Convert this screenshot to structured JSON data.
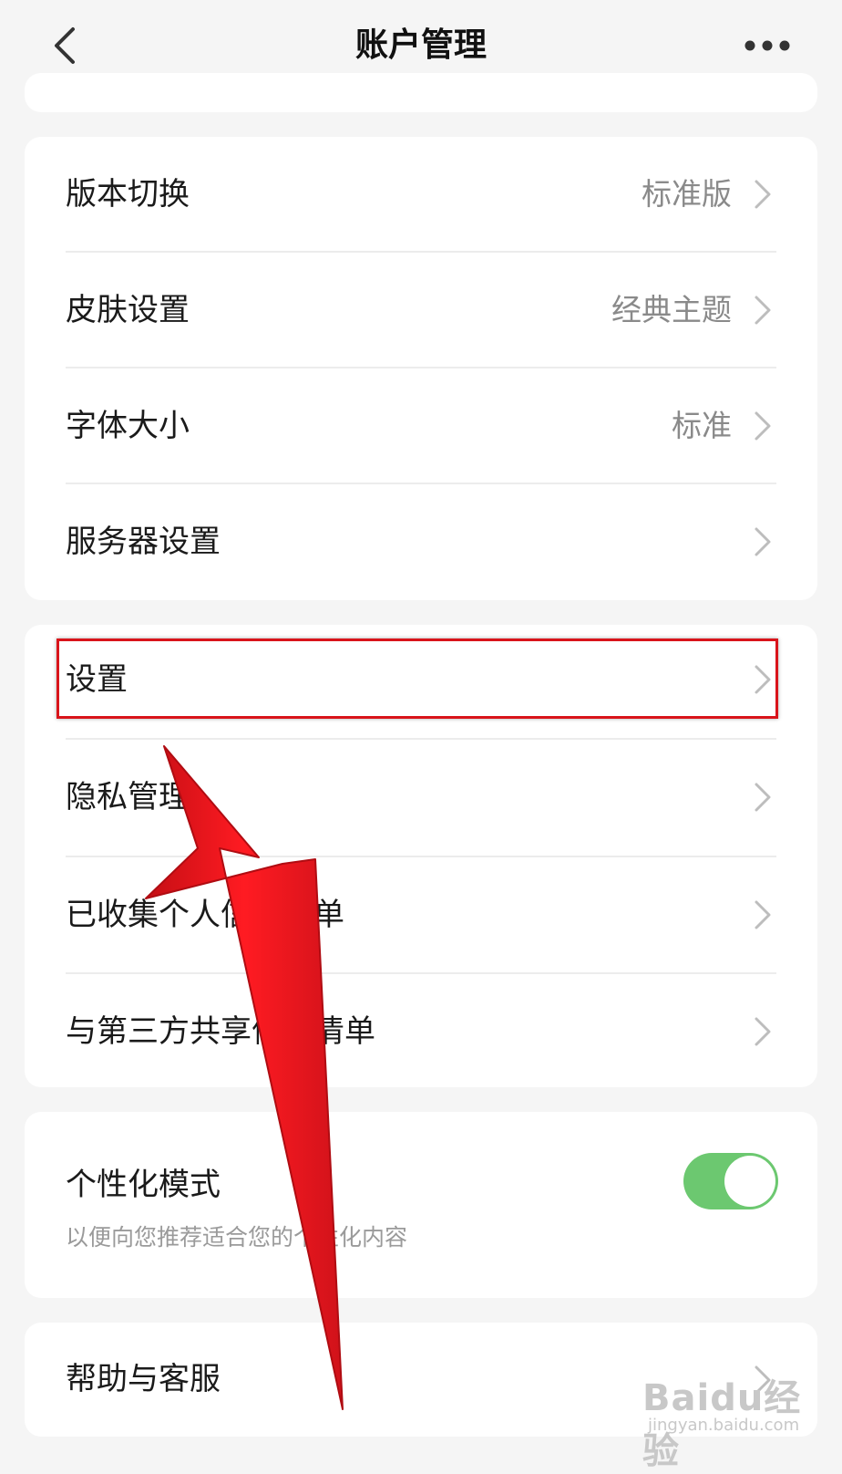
{
  "header": {
    "title": "账户管理",
    "back_icon": "chevron-left-icon",
    "more_icon": "more-dots-icon"
  },
  "group1": [
    {
      "label": "版本切换",
      "value": "标准版"
    },
    {
      "label": "皮肤设置",
      "value": "经典主题"
    },
    {
      "label": "字体大小",
      "value": "标准"
    },
    {
      "label": "服务器设置",
      "value": ""
    }
  ],
  "group2": [
    {
      "label": "设置"
    },
    {
      "label": "隐私管理"
    },
    {
      "label": "已收集个人信息清单"
    },
    {
      "label": "与第三方共享信息清单"
    }
  ],
  "personalization": {
    "label": "个性化模式",
    "description": "以便向您推荐适合您的个性化内容",
    "toggle_on": true
  },
  "help": {
    "label": "帮助与客服"
  },
  "watermark": {
    "logo": "Baidu经验",
    "url": "jingyan.baidu.com"
  },
  "colors": {
    "toggle_on": "#6cc870",
    "highlight": "#d9141b",
    "arrow": "#e8141c"
  }
}
